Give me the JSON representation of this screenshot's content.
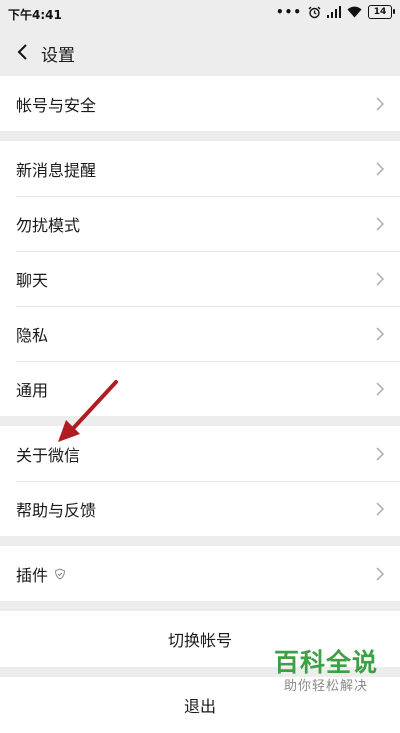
{
  "status_bar": {
    "time": "下午4:41",
    "battery": "14"
  },
  "nav": {
    "title": "设置"
  },
  "group1": [
    {
      "label": "帐号与安全"
    }
  ],
  "group2": [
    {
      "label": "新消息提醒"
    },
    {
      "label": "勿扰模式"
    },
    {
      "label": "聊天"
    },
    {
      "label": "隐私"
    },
    {
      "label": "通用"
    }
  ],
  "group3": [
    {
      "label": "关于微信"
    },
    {
      "label": "帮助与反馈"
    }
  ],
  "group4": [
    {
      "label": "插件"
    }
  ],
  "actions": {
    "switch_account": "切换帐号",
    "logout": "退出"
  },
  "watermark": {
    "brand": "百科全说",
    "tagline": "助你轻松解决"
  },
  "colors": {
    "background": "#ededed",
    "arrow": "#b01c22",
    "watermark": "#3da043"
  }
}
